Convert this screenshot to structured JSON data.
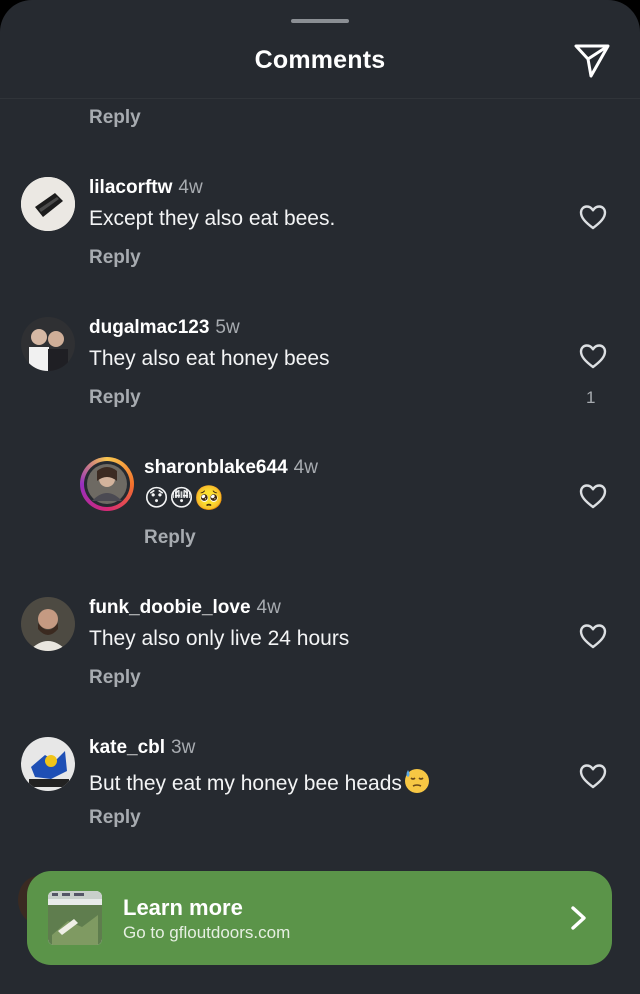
{
  "header": {
    "title": "Comments"
  },
  "top_reply": {
    "label": "Reply"
  },
  "comments": [
    {
      "username": "lilacorftw",
      "time": "4w",
      "text": "Except they also eat bees.",
      "reply": "Reply",
      "like_count": ""
    },
    {
      "username": "dugalmac123",
      "time": "5w",
      "text": "They also eat honey bees",
      "reply": "Reply",
      "like_count": "1"
    },
    {
      "username": "sharonblake644",
      "time": "4w",
      "text": "😯😳🥺",
      "reply": "Reply",
      "like_count": ""
    },
    {
      "username": "funk_doobie_love",
      "time": "4w",
      "text": "They also only live 24 hours",
      "reply": "Reply",
      "like_count": ""
    },
    {
      "username": "kate_cbl",
      "time": "3w",
      "text": "But they eat my honey bee heads",
      "reply": "Reply",
      "like_count": ""
    }
  ],
  "cta": {
    "title": "Learn more",
    "subtitle": "Go to gfloutdoors.com"
  },
  "colors": {
    "background": "#262a30",
    "cta": "#5b9449",
    "secondary_text": "#a7abb0"
  },
  "icons": [
    "send-icon",
    "heart-icon",
    "chevron-right-icon",
    "downcast-sweat-emoji"
  ]
}
